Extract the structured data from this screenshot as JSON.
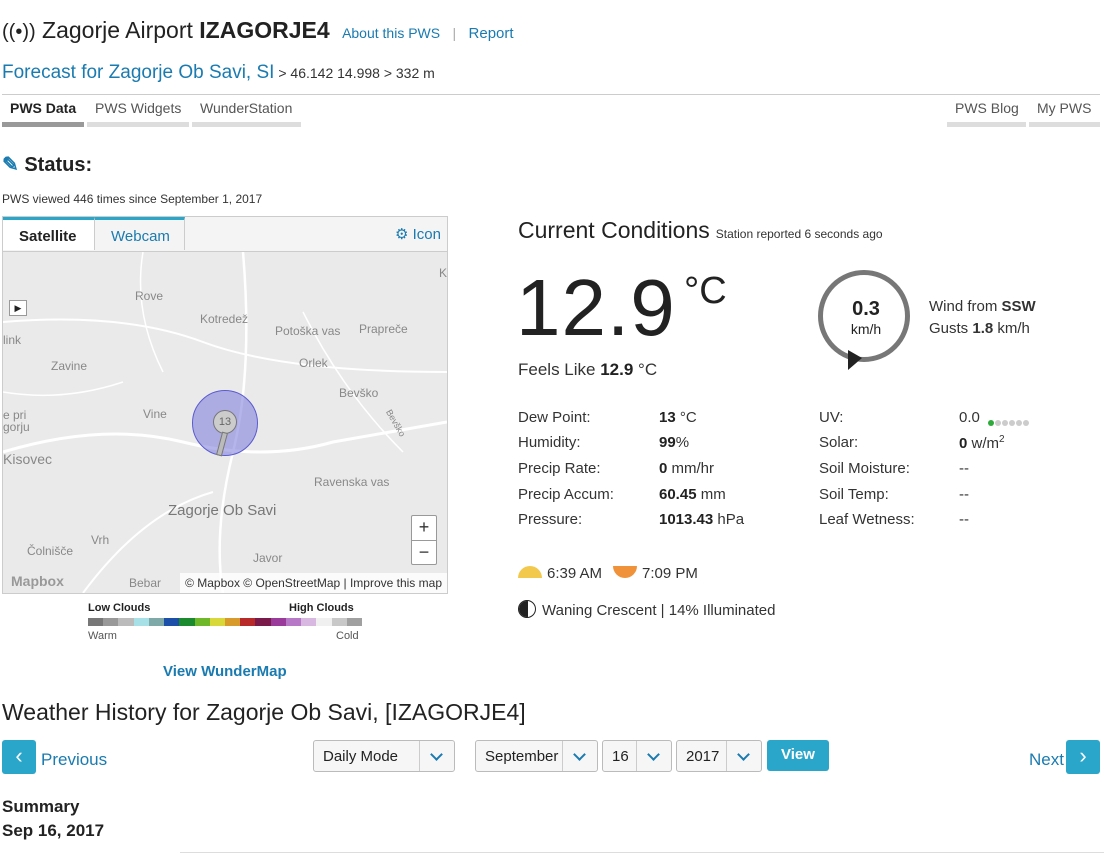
{
  "header": {
    "station_name": "Zagorje Airport",
    "station_id": "IZAGORJE4",
    "about_link": "About this PWS",
    "report_link": "Report"
  },
  "forecast": {
    "link": "Forecast for Zagorje Ob Savi, SI",
    "coords": " > 46.142 14.998 > 332 m"
  },
  "tabs_left": [
    "PWS Data",
    "PWS Widgets",
    "WunderStation"
  ],
  "tabs_right": [
    "PWS Blog",
    "My PWS"
  ],
  "status": {
    "title": "Status:",
    "viewed": "PWS viewed 446 times since September 1, 2017"
  },
  "map": {
    "tab_satellite": "Satellite",
    "tab_webcam": "Webcam",
    "icon_link": "Icon",
    "labels": {
      "rove": "Rove",
      "kotredez": "Kotredež",
      "potoska": "Potoška vas",
      "prapréce": "Prapreče",
      "zavine": "Zavine",
      "orlek": "Orlek",
      "bevsko": "Bevško",
      "vine": "Vine",
      "kisovec": "Kisovec",
      "ravenska": "Ravenska vas",
      "zagorje": "Zagorje Ob Savi",
      "vrh": "Vrh",
      "colnisce": "Čolnišče",
      "javor": "Javor",
      "bebar": "Bebar",
      "link_edge": "link",
      "epri": "e pri",
      "gorju": "gorju",
      "kl": "Kl",
      "bevsko_road": "Bevško"
    },
    "marker_value": "13",
    "zoom_in": "+",
    "zoom_out": "−",
    "attribution": "© Mapbox © OpenStreetMap | Improve this map",
    "logo": "Mapbox"
  },
  "cloud_legend": {
    "low": "Low Clouds",
    "high": "High Clouds",
    "warm": "Warm",
    "cold": "Cold",
    "colors": [
      "#777",
      "#999",
      "#bbb",
      "#a8e0e8",
      "#7fa8a8",
      "#1b4fa8",
      "#1b8a2e",
      "#6fb82a",
      "#d8d83a",
      "#d89a2a",
      "#b82a2a",
      "#7a1a4a",
      "#9a3a9a",
      "#b878c8",
      "#d8b8e0",
      "#f0f0f0",
      "#c8c8c8",
      "#a0a0a0"
    ]
  },
  "view_wundermap": "View WunderMap",
  "conditions": {
    "title": "Current Conditions",
    "reported": "Station reported 6 seconds ago",
    "temp": "12.9",
    "temp_unit": "°C",
    "feels_label": "Feels Like ",
    "feels_value": "12.9",
    "feels_unit": " °C",
    "wind_speed": "0.3",
    "wind_unit": "km/h",
    "wind_from_label": "Wind from ",
    "wind_dir": "SSW",
    "gusts_label": "Gusts ",
    "gusts_value": "1.8",
    "gusts_unit": " km/h",
    "left": [
      {
        "label": "Dew Point:",
        "value": "13",
        "unit": " °C"
      },
      {
        "label": "Humidity:",
        "value": "99",
        "unit": "%"
      },
      {
        "label": "Precip Rate:",
        "value": "0",
        "unit": " mm/hr"
      },
      {
        "label": "Precip Accum:",
        "value": "60.45",
        "unit": " mm"
      },
      {
        "label": "Pressure:",
        "value": "1013.43",
        "unit": " hPa"
      }
    ],
    "right": [
      {
        "label": "UV:",
        "value": "0.0"
      },
      {
        "label": "Solar:",
        "value": "0",
        "unit": " w/m",
        "sup": "2"
      },
      {
        "label": "Soil Moisture:",
        "value": "--"
      },
      {
        "label": "Soil Temp:",
        "value": "--"
      },
      {
        "label": "Leaf Wetness:",
        "value": "--"
      }
    ],
    "sunrise": "6:39 AM",
    "sunset": "7:09 PM",
    "moon": "Waning Crescent | 14% Illuminated"
  },
  "history": {
    "title": "Weather History for Zagorje Ob Savi, [IZAGORJE4]",
    "previous": "Previous",
    "next": "Next",
    "mode": "Daily Mode",
    "month": "September",
    "day": "16",
    "year": "2017",
    "view_btn": "View",
    "summary": "Summary",
    "date": "Sep 16, 2017"
  }
}
